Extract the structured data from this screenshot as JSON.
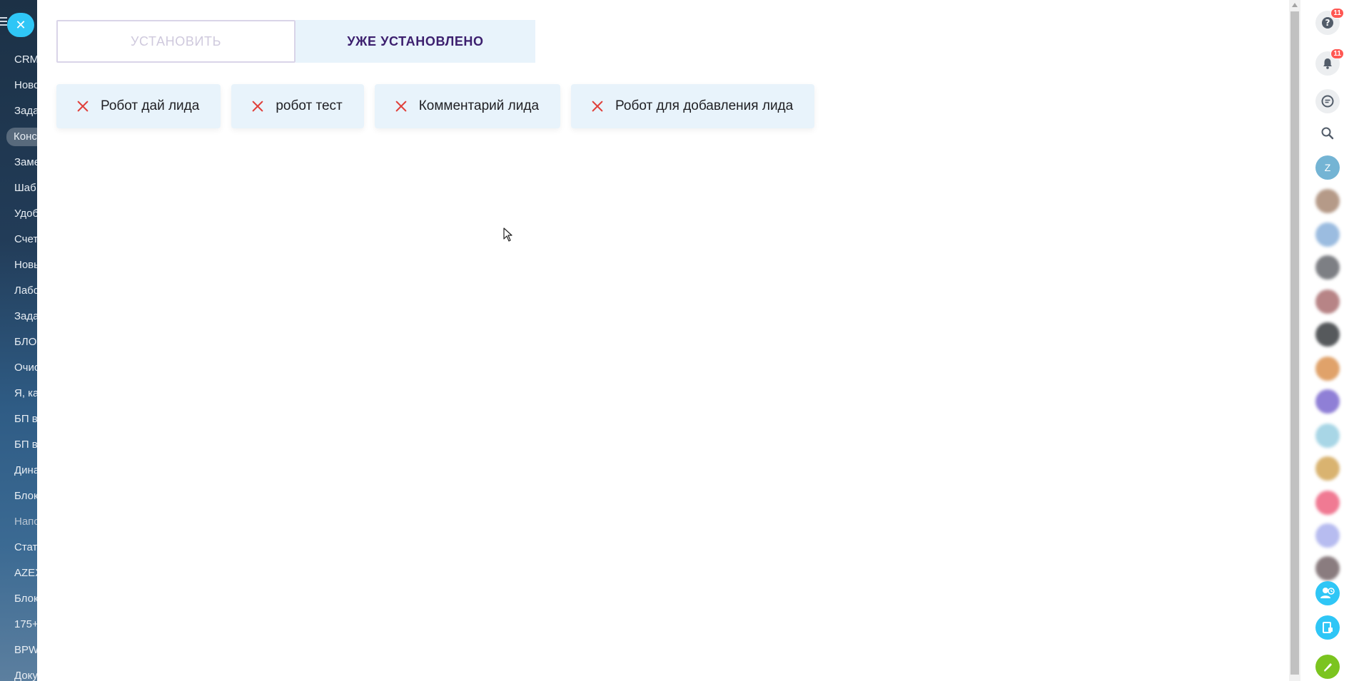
{
  "left_sidebar": {
    "items": [
      {
        "label": "CRM"
      },
      {
        "label": "Ново"
      },
      {
        "label": "Зада"
      },
      {
        "label": "Конс",
        "active": true
      },
      {
        "label": "Заме"
      },
      {
        "label": "Шаб"
      },
      {
        "label": "Удоб"
      },
      {
        "label": "Счет"
      },
      {
        "label": "Новы"
      },
      {
        "label": "Лабо"
      },
      {
        "label": "Зада"
      },
      {
        "label": "БЛО"
      },
      {
        "label": "Очис"
      },
      {
        "label": "Я, ка"
      },
      {
        "label": "БП в"
      },
      {
        "label": "БП в"
      },
      {
        "label": "Дина"
      },
      {
        "label": "Блок"
      },
      {
        "label": "Напо"
      },
      {
        "label": "Стат"
      },
      {
        "label": "AZEX"
      },
      {
        "label": "Блок"
      },
      {
        "label": "175+"
      },
      {
        "label": "BPW"
      },
      {
        "label": "Доку"
      }
    ]
  },
  "tabs": {
    "install": "УСТАНОВИТЬ",
    "installed": "УЖЕ УСТАНОВЛЕНО"
  },
  "installed_robots": [
    {
      "label": "Робот дай лида"
    },
    {
      "label": "робот тест"
    },
    {
      "label": "Комментарий лида"
    },
    {
      "label": "Робот для добавления лида"
    }
  ],
  "right_rail": {
    "help_badge": "11",
    "notifications_badge": "11",
    "user_initial": "Z",
    "avatar_colors": [
      "#b59a88",
      "#9bbce0",
      "#7d7f84",
      "#b78486",
      "#56595c",
      "#e0a26a",
      "#8f7fd6",
      "#a8d6e6",
      "#d9b370",
      "#f07a93",
      "#b7bcf0",
      "#8a7c7f"
    ],
    "accent": "#2fc6f6",
    "phone_color": "#7bc41f"
  }
}
